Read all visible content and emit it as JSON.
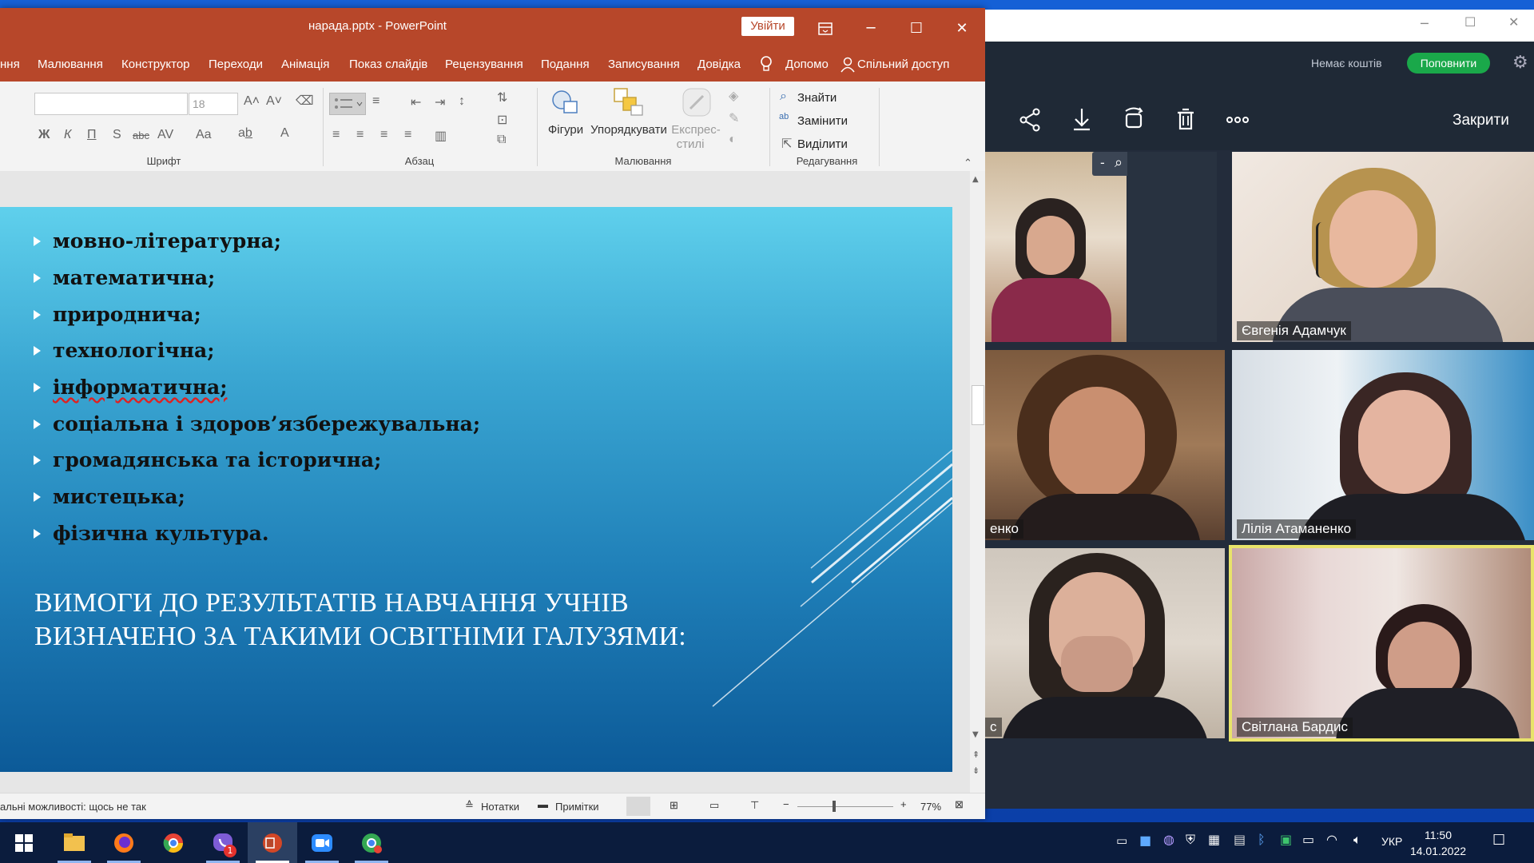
{
  "powerpoint": {
    "window_title": "нарада.pptx  -  PowerPoint",
    "signin_label": "Увійти",
    "menu_tabs": [
      "ння",
      "Малювання",
      "Конструктор",
      "Переходи",
      "Анімація",
      "Показ слайдів",
      "Рецензування",
      "Подання",
      "Записування",
      "Довідка",
      "Допомо",
      "Спільний доступ"
    ],
    "ribbon": {
      "font_size_value": "18",
      "group_font": "Шрифт",
      "group_paragraph": "Абзац",
      "group_drawing": "Малювання",
      "group_editing": "Редагування",
      "shapes_label": "Фігури",
      "arrange_label": "Упорядкувати",
      "quick_styles_label_1": "Експрес-",
      "quick_styles_label_2": "стилі",
      "find_label": "Знайти",
      "replace_label": "Замінити",
      "select_label": "Виділити",
      "bold": "Ж",
      "italic": "К",
      "underline": "П",
      "strike": "S",
      "abc": "abc",
      "av": "AV",
      "aa": "Aa",
      "font_color": "A"
    },
    "slide": {
      "bullets": [
        "мовно-літературна;",
        "математична;",
        "природнича;",
        "технологічна;",
        "інформатична;",
        "соціальна і здоров’язбережувальна;",
        "громадянська та історична;",
        "мистецька;",
        "фізична культура."
      ],
      "heading": "ВИМОГИ ДО РЕЗУЛЬТАТІВ  НАВЧАННЯ УЧНІВ ВИЗНАЧЕНО ЗА ТАКИМИ ОСВІТНІМИ ГАЛУЗЯМИ:"
    },
    "status": {
      "accessibility": "альні можливості: щось не так",
      "notes": "Нотатки",
      "comments": "Примітки",
      "zoom": "77%"
    }
  },
  "meeting": {
    "no_funds": "Немає коштів",
    "topup": "Поповнити",
    "close": "Закрити",
    "participants": [
      {
        "name": ""
      },
      {
        "name": "Євгенія Адамчук"
      },
      {
        "name": "енко"
      },
      {
        "name": "Лілія Атаманенко"
      },
      {
        "name": "с"
      },
      {
        "name": "Світлана Бардис"
      }
    ],
    "zoom_minus": "-",
    "zoom_plus": "+"
  },
  "taskbar": {
    "lang": "УКР",
    "time": "11:50",
    "date": "14.01.2022",
    "viber_badge": "1"
  },
  "colors": {
    "ppt_accent": "#b7472a",
    "topup_green": "#1aa84a",
    "active_speaker": "#e8e36a"
  }
}
